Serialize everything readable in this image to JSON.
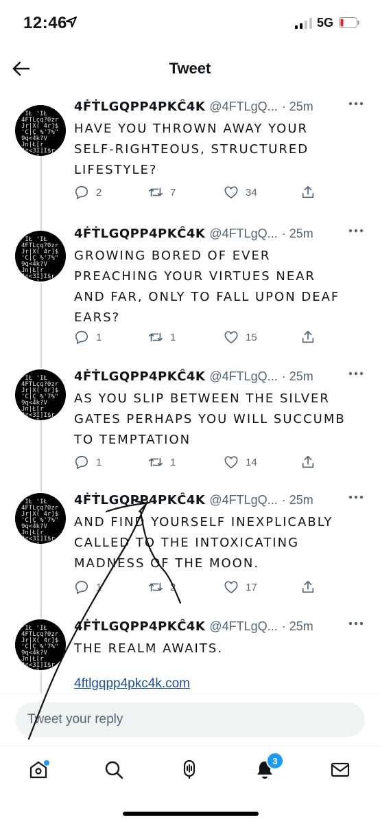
{
  "status_bar": {
    "time": "12:46",
    "network": "5G"
  },
  "header": {
    "title": "Tweet"
  },
  "tweets": [
    {
      "name": "4ḞṪLGQPP4PKĈ4K",
      "handle": "@4FTLgQ...",
      "time": "· 25m",
      "text": "HAVE YOU THROWN AWAY YOUR SELF-RIGHTEOUS, STRUCTURED LIFESTYLE?",
      "replies": "2",
      "retweets": "7",
      "likes": "34"
    },
    {
      "name": "4ḞṪLGQPP4PKĈ4K",
      "handle": "@4FTLgQ...",
      "time": "· 25m",
      "text": "GROWING BORED OF EVER PREACHING YOUR VIRTUES NEAR AND FAR, ONLY TO FALL UPON DEAF EARS?",
      "replies": "1",
      "retweets": "1",
      "likes": "15"
    },
    {
      "name": "4ḞṪLGQPP4PKĈ4K",
      "handle": "@4FTLgQ...",
      "time": "· 25m",
      "text": "AS YOU SLIP BETWEEN THE SILVER GATES PERHAPS YOU WILL SUCCUMB TO TEMPTATION",
      "replies": "1",
      "retweets": "1",
      "likes": "14"
    },
    {
      "name": "4ḞṪLGQPP4PKĈ4K",
      "handle": "@4FTLgQ...",
      "time": "· 25m",
      "text": "AND FIND YOURSELF INEXPLICABLY CALLED TO THE INTOXICATING MADNESS OF THE MOON.",
      "replies": "1",
      "retweets": "2",
      "likes": "17"
    },
    {
      "name": "4ḞṪLGQPP4PKĈ4K",
      "handle": "@4FTLgQ...",
      "time": "· 25m",
      "text": "THE REALM AWAITS.",
      "link": "4ftlgqpp4pkc4k.com"
    }
  ],
  "reply_bar": {
    "placeholder": "Tweet your reply"
  },
  "bottom_nav": {
    "notifications_badge": "3"
  },
  "avatar_art": "'IŁ 'IŁ\n4FTLçq?0zr\nJr|X( 4r]$\n'C|Ç %'7%\"\n9q<4k?V\nJn|Ł[r\nJ¢<3I]I$r\nŁIŁ<]\n'IŁ{k2",
  "colors": {
    "accent": "#1d9bf0",
    "text": "#0f1419",
    "secondary": "#536471",
    "link": "#1d4f91"
  },
  "icons": [
    "location-arrow-icon",
    "signal-icon",
    "battery-icon",
    "back-arrow-icon",
    "more-icon",
    "reply-icon",
    "retweet-icon",
    "like-icon",
    "share-icon",
    "home-icon",
    "search-icon",
    "spaces-icon",
    "notifications-icon",
    "messages-icon"
  ]
}
